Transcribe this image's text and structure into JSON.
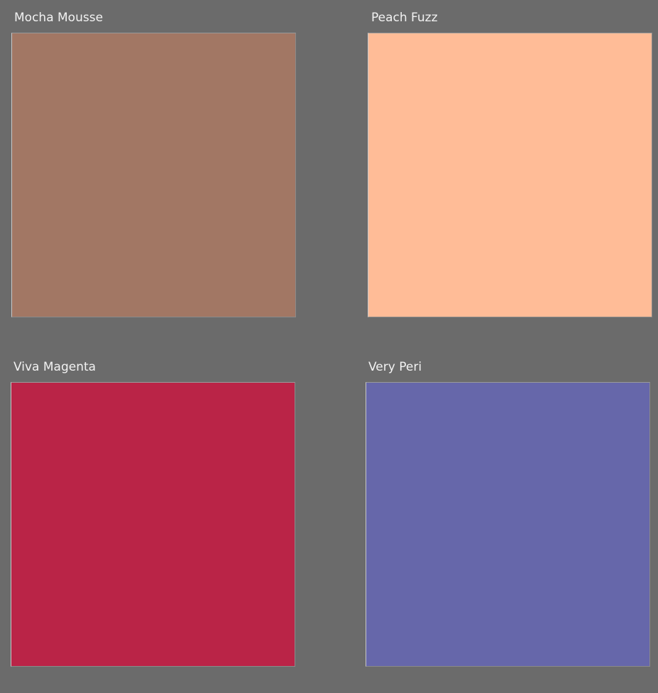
{
  "swatches": [
    {
      "name": "Mocha Mousse",
      "color": "#a27764"
    },
    {
      "name": "Peach Fuzz",
      "color": "#ffbc97"
    },
    {
      "name": "Viva Magenta",
      "color": "#ba2447"
    },
    {
      "name": "Very Peri",
      "color": "#6667aa"
    }
  ]
}
